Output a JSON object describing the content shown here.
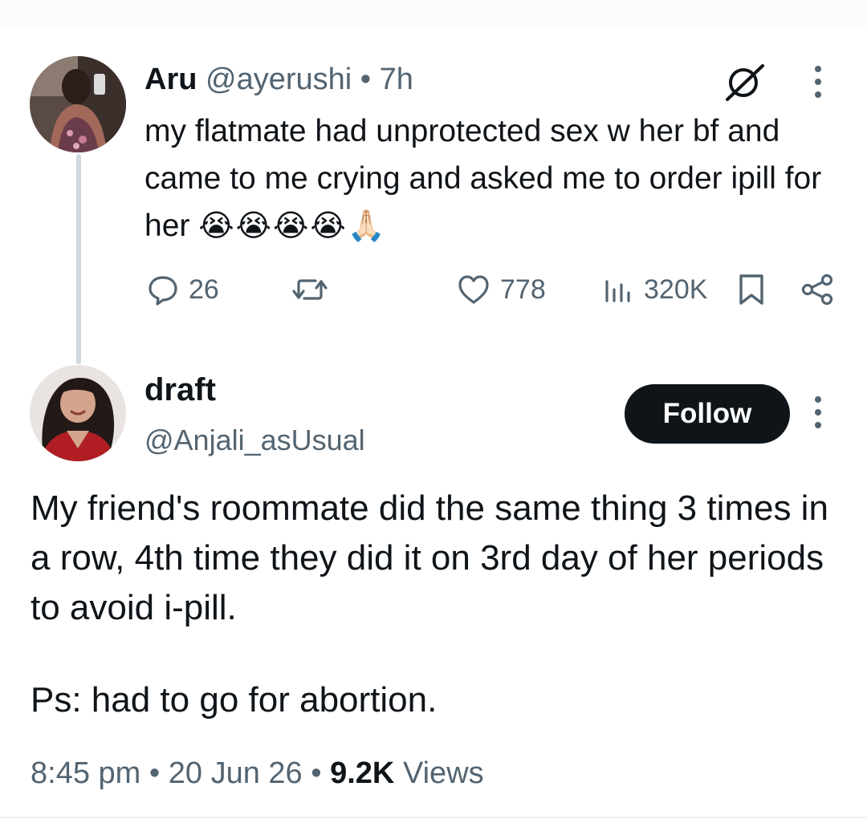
{
  "parent_tweet": {
    "display_name": "Aru",
    "handle": "@ayerushi",
    "separator": "•",
    "time": "7h",
    "text": "my flatmate had unprotected sex w her bf and came to me crying and asked me to order ipill for her ",
    "emoji": "😭😭😭😭🙏🏻",
    "replies": "26",
    "reposts": "",
    "likes": "778",
    "views": "320K",
    "icons": [
      "grok-icon",
      "more-icon",
      "reply-icon",
      "repost-icon",
      "like-icon",
      "views-icon",
      "bookmark-icon",
      "share-icon"
    ]
  },
  "reply_tweet": {
    "display_name": "draft",
    "handle": "@Anjali_asUsual",
    "follow_label": "Follow",
    "text": "My friend's roommate did the same thing 3 times in a row, 4th time they did it on 3rd day of her periods to avoid i-pill.",
    "ps": "Ps: had to go for abortion.",
    "time": "8:45 pm",
    "separator": "•",
    "date": "20 Jun 26",
    "views_count": "9.2K",
    "views_label": "Views"
  },
  "colors": {
    "text": "#0f1419",
    "secondary": "#536471",
    "thread_line": "#cfd9de",
    "follow_bg": "#0f1419"
  }
}
